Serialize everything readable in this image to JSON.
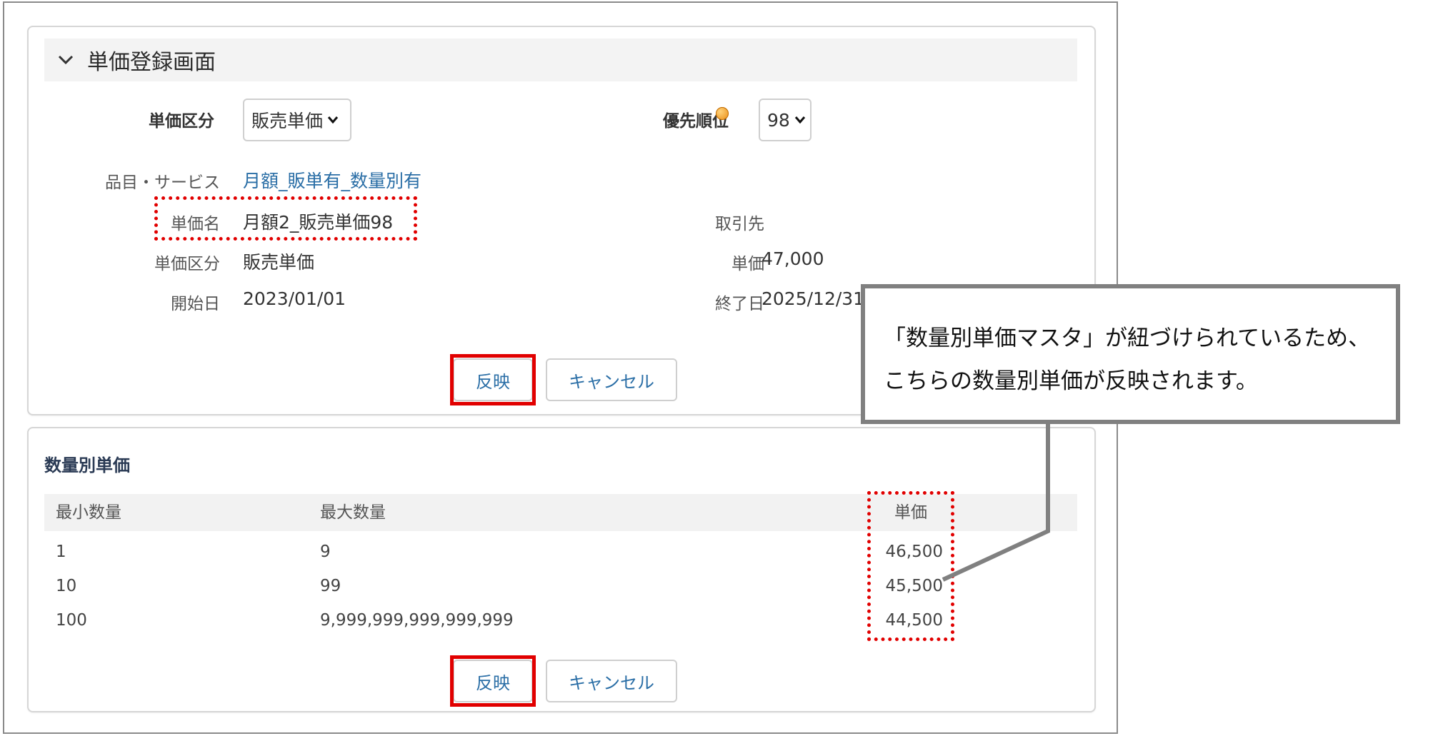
{
  "registration": {
    "title": "単価登録画面",
    "price_type_label": "単価区分",
    "price_type_value": "販売単価",
    "priority_label": "優先順位",
    "priority_value": "98"
  },
  "details": {
    "item_label": "品目・サービス",
    "item_value": "月額_販単有_数量別有",
    "name_label": "単価名",
    "name_value": "月額2_販売単価98",
    "partner_label": "取引先",
    "type_label": "単価区分",
    "type_value": "販売単価",
    "unit_price_label": "単価",
    "unit_price_value": "47,000",
    "start_label": "開始日",
    "start_value": "2023/01/01",
    "end_label": "終了日",
    "end_value": "2025/12/31"
  },
  "buttons": {
    "apply": "反映",
    "cancel": "キャンセル"
  },
  "quantity_table": {
    "title": "数量別単価",
    "headers": [
      "最小数量",
      "最大数量",
      "単価"
    ],
    "rows": [
      {
        "min": "1",
        "max": "9",
        "price": "46,500"
      },
      {
        "min": "10",
        "max": "99",
        "price": "45,500"
      },
      {
        "min": "100",
        "max": "9,999,999,999,999,999",
        "price": "44,500"
      }
    ]
  },
  "callout": {
    "line1": "「数量別単価マスタ」が紐づけられているため、",
    "line2": "こちらの数量別単価が反映されます。"
  },
  "colors": {
    "highlight": "#e10000",
    "link": "#2a6ea6",
    "callout_border": "#808080"
  }
}
